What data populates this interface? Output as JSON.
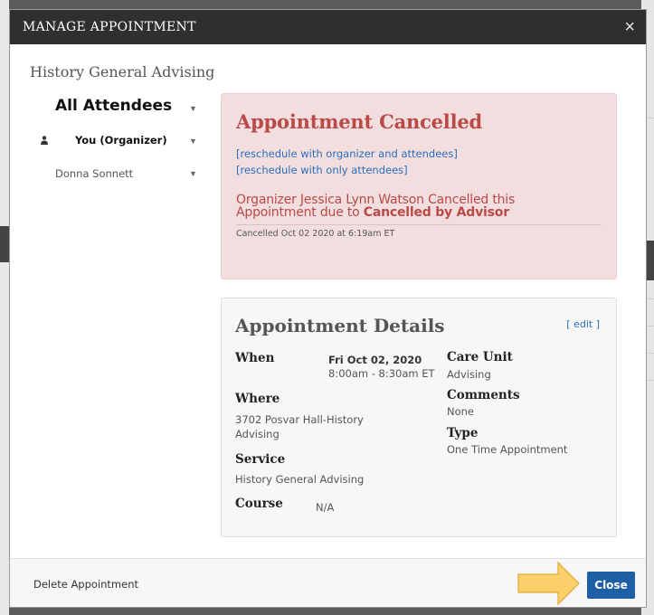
{
  "modal": {
    "title": "MANAGE APPOINTMENT",
    "close_icon": "×",
    "subtitle": "History General Advising"
  },
  "attendees": {
    "all_label": "All Attendees",
    "you_label": "You (Organizer)",
    "other_label": "Donna Sonnett"
  },
  "cancel": {
    "title": "Appointment Cancelled",
    "reschedule_all": "[reschedule with organizer and attendees]",
    "reschedule_attendees": "[reschedule with only attendees]",
    "message_line1": "Organizer Jessica Lynn Watson Cancelled this",
    "message_line2_prefix": "Appointment due to ",
    "reason": "Cancelled by Advisor",
    "date": "Cancelled Oct 02 2020 at 6:19am ET"
  },
  "details": {
    "title": "Appointment Details",
    "edit": "[ edit ]",
    "when_label": "When",
    "when_date": "Fri Oct 02, 2020",
    "when_time": "8:00am - 8:30am ET",
    "where_label": "Where",
    "where_line1": "3702 Posvar Hall-History",
    "where_line2": "Advising",
    "service_label": "Service",
    "service_value": "History General Advising",
    "course_label": "Course",
    "course_value": "N/A",
    "care_unit_label": "Care Unit",
    "care_unit_value": "Advising",
    "comments_label": "Comments",
    "comments_value": "None",
    "type_label": "Type",
    "type_value": "One Time Appointment"
  },
  "footer": {
    "delete_label": "Delete Appointment",
    "close_label": "Close"
  },
  "colors": {
    "header_bg": "#2f2f2f",
    "danger_text": "#b94a48",
    "danger_bg": "#f2dede",
    "link": "#2a6ebb",
    "primary_button": "#1f5fa6",
    "arrow": "#fbd06b"
  },
  "icons": {
    "attendee": "person-icon",
    "dropdown": "caret-down-icon",
    "pointer": "arrow-right-icon"
  }
}
